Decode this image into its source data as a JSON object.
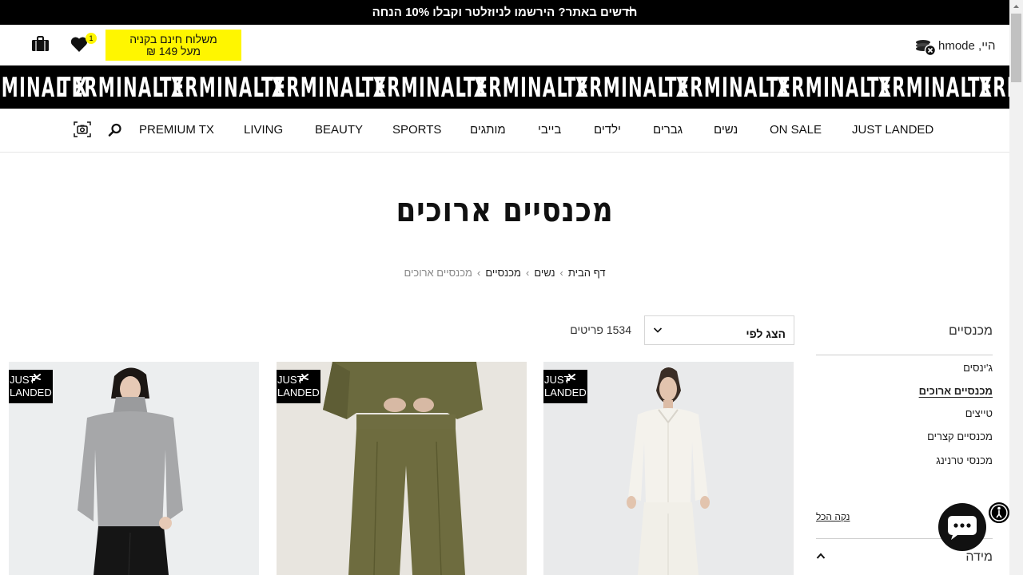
{
  "announcement": {
    "text": "חדשים באתר? הירשמו לניוזלטר וקבלו 10% הנחה",
    "plus_icon": "plus-icon"
  },
  "header": {
    "shipping_line1": "משלוח חינם בקניה",
    "shipping_line2": "מעל 149 ₪",
    "wishlist_count": "1",
    "greeting": "היי, hmode"
  },
  "brand": {
    "wordmark": "TERMINAL X"
  },
  "nav": {
    "items": [
      {
        "label": "JUST LANDED"
      },
      {
        "label": "ON SALE"
      },
      {
        "label": "נשים"
      },
      {
        "label": "גברים"
      },
      {
        "label": "ילדים"
      },
      {
        "label": "בייבי"
      },
      {
        "label": "מותגים"
      },
      {
        "label": "SPORTS"
      },
      {
        "label": "BEAUTY"
      },
      {
        "label": "LIVING"
      },
      {
        "label": "PREMIUM TX"
      }
    ]
  },
  "page": {
    "title": "מכנסיים ארוכים",
    "breadcrumb": [
      "דף הבית",
      "נשים",
      "מכנסיים",
      "מכנסיים ארוכים"
    ],
    "sort_label": "הצג לפי",
    "count": "1534 פריטים"
  },
  "filters": {
    "heading": "מכנסיים",
    "links": [
      {
        "label": "ג'ינסים",
        "active": false
      },
      {
        "label": "מכנסיים ארוכים",
        "active": true
      },
      {
        "label": "טייצים",
        "active": false
      },
      {
        "label": "מכנסיים קצרים",
        "active": false
      },
      {
        "label": "מכנסי טרנינג",
        "active": false
      }
    ],
    "clear_all": "נקה הכל",
    "size_label": "מידה"
  },
  "products": [
    {
      "badge_line1": "JUST",
      "badge_line2": "LANDED"
    },
    {
      "badge_line1": "JUST",
      "badge_line2": "LANDED"
    },
    {
      "badge_line1": "JUST",
      "badge_line2": "LANDED"
    }
  ],
  "colors": {
    "accent_yellow": "#fff600",
    "black": "#000000"
  }
}
